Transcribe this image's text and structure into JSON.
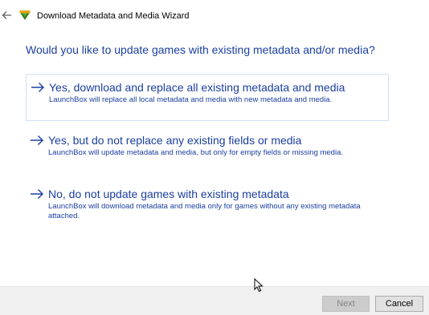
{
  "window": {
    "title": "Download Metadata and Media Wizard",
    "back_icon": "back-arrow-icon",
    "app_icon": "launchbox-icon"
  },
  "instruction": "Would you like to update games with existing metadata and/or media?",
  "options": [
    {
      "title": "Yes, download and replace all existing metadata and media",
      "description": "LaunchBox will replace all local metadata and media with new metadata and media.",
      "icon": "arrow-right-icon",
      "selected": true
    },
    {
      "title": "Yes, but do not replace any existing fields or media",
      "description": "LaunchBox will update metadata and media, but only for empty fields or missing media.",
      "icon": "arrow-right-icon",
      "selected": false
    },
    {
      "title": "No, do not update games with existing metadata",
      "description": "LaunchBox will download metadata and media only for games without any existing metadata attached.",
      "icon": "arrow-right-icon",
      "selected": false
    }
  ],
  "footer": {
    "next_label": "Next",
    "next_enabled": false,
    "cancel_label": "Cancel"
  },
  "colors": {
    "link_blue": "#1b3fa0",
    "selection_border": "#cfe1f4",
    "footer_bg": "#f0f0f0"
  }
}
